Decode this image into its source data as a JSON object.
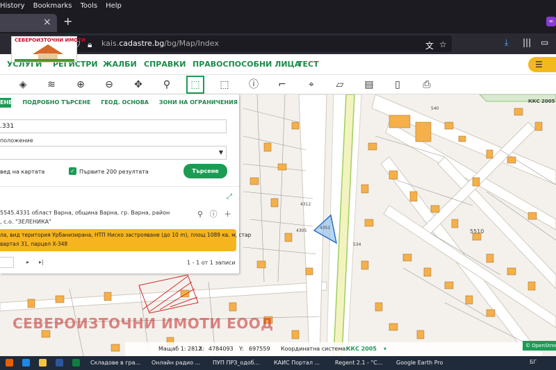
{
  "browser": {
    "menu": [
      "History",
      "Bookmarks",
      "Tools",
      "Help"
    ],
    "url_prefix": "kais.",
    "url_domain": "cadastre.bg",
    "url_path": "/bg/Map/Index",
    "new_tab": "+",
    "tab_close": "×"
  },
  "logo": {
    "text": "СЕВЕРОИЗТОЧНИ ИМОТИ"
  },
  "site_nav": {
    "items": [
      "УСЛУГИ",
      "РЕГИСТРИ",
      "ЖАЛБИ",
      "СПРАВКИ",
      "ПРАВОСПОСОБНИ ЛИЦА",
      "ТЕСТ"
    ],
    "menu_icon": "☰"
  },
  "toolbar": {
    "tools": [
      "layers-icon",
      "stack-icon",
      "zoom-in-icon",
      "zoom-out-icon",
      "pan-icon",
      "marker-icon",
      "select-rect-icon",
      "deselect-icon",
      "info-icon",
      "measure-icon",
      "crosshair-icon",
      "polygon-icon",
      "map-icon",
      "bookmark-icon",
      "document-icon",
      "print-icon"
    ],
    "active": "select-rect-icon"
  },
  "panel": {
    "tabs": [
      "ЕНЕ",
      "ПОДРОБНО ТЪРСЕНЕ",
      "ГЕОД. ОСНОВА",
      "ЗОНИ НА ОГРАНИЧЕНИЯ"
    ],
    "field1_value": ".331",
    "label2": "положение",
    "checkbox1_label": "вед на картата",
    "checkbox2_label": "Първите 200 резултата",
    "search_button": "Търсене",
    "result_line1": "5545.4331 област Варна, община Варна, гр. Варна, район",
    "result_line2": ", с.о. \"ЗЕЛЕНИКА\"",
    "yellow_line1": "ла, вид територия Урбанизирана, НТП Ниско застрояване (до 10 m), площ 1089 кв. м, стар",
    "yellow_line2": "вартал 31, парцел X-348",
    "pager_next": "▸",
    "pager_last": "▸|",
    "records": "1 - 1 от 1 записи"
  },
  "map": {
    "watermark": "СЕВЕРОИЗТОЧНИ ИМОТИ ЕООД",
    "labels": [
      {
        "text": "ККС 2005"
      },
      {
        "text": "5510"
      },
      {
        "text": "540"
      },
      {
        "text": "534"
      },
      {
        "text": "4312"
      },
      {
        "text": "4351"
      },
      {
        "text": "4305"
      }
    ],
    "scale_label": "Мащаб 1:",
    "scale_value": "2812",
    "x_label": "X:",
    "x_value": "4784093",
    "y_label": "Y:",
    "y_value": "697559",
    "crs_label": "Координатна система:",
    "crs_value": "ККС 2005",
    "attribution": "© OpenStreetMap"
  },
  "taskbar": {
    "apps": [
      "Складове в гра...",
      "Онлайн радио ...",
      "ПУП ПРЗ_одоб...",
      "КАИС Портал ...",
      "Regent 2.1 - \"С...",
      "Google Earth Pro"
    ],
    "tray": "БГ"
  },
  "colors": {
    "brand_green": "#1c9b55",
    "accent_yellow": "#f6b51f",
    "parcel_highlight": "#3b8fd9"
  }
}
